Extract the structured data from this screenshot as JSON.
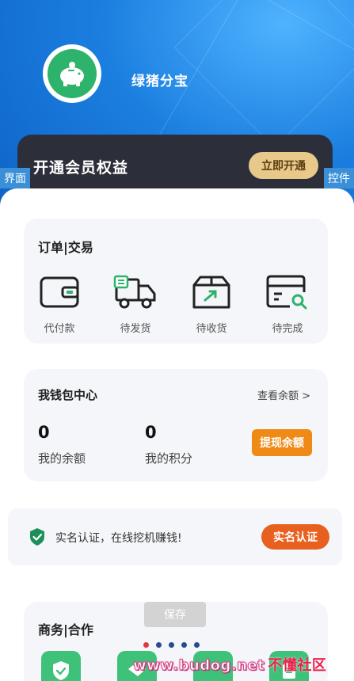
{
  "profile": {
    "username": "绿猪分宝"
  },
  "vip": {
    "title": "开通会员权益",
    "button": "立即开通"
  },
  "tags": {
    "left": "界面",
    "right": "控件"
  },
  "orders": {
    "title": "订单|交易",
    "items": [
      {
        "label": "代付款",
        "icon": "wallet-icon"
      },
      {
        "label": "待发货",
        "icon": "truck-icon"
      },
      {
        "label": "待收货",
        "icon": "package-icon"
      },
      {
        "label": "待完成",
        "icon": "card-search-icon"
      }
    ]
  },
  "wallet": {
    "title": "我钱包中心",
    "link": "查看余额 >",
    "balance_value": "0",
    "balance_label": "我的余额",
    "points_value": "0",
    "points_label": "我的积分",
    "withdraw": "提现余额"
  },
  "verify": {
    "text": "实名认证，在线挖机赚钱!",
    "button": "实名认证"
  },
  "business": {
    "title": "商务|合作"
  },
  "save": {
    "label": "保存"
  },
  "carousel": {
    "count": 5,
    "active": 0
  },
  "watermark": {
    "url": "www.budog.net",
    "cn": "不懂社区"
  },
  "colors": {
    "brand_green": "#2db36b",
    "hero_blue": "#1b7fe0",
    "vip_gold": "#e8c98a",
    "orange": "#f08a16",
    "verify_orange": "#e8601f"
  }
}
